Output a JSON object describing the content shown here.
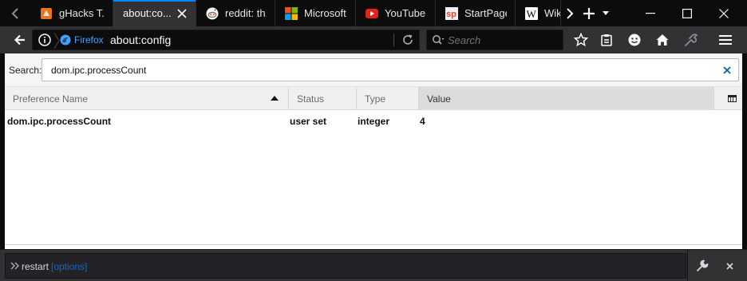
{
  "tabs": [
    {
      "title": "gHacks T...",
      "icon": "ghacks-favicon",
      "selected": false
    },
    {
      "title": "about:co...",
      "icon": "none",
      "selected": true
    },
    {
      "title": "reddit: th...",
      "icon": "reddit-favicon",
      "selected": false
    },
    {
      "title": "Microsoft...",
      "icon": "microsoft-favicon",
      "selected": false
    },
    {
      "title": "YouTube",
      "icon": "youtube-favicon",
      "selected": false
    },
    {
      "title": "StartPage...",
      "icon": "startpage-favicon",
      "selected": false
    },
    {
      "title": "Wikip",
      "icon": "wikipedia-favicon",
      "selected": false
    }
  ],
  "navbar": {
    "identity_label": "Firefox",
    "url": "about:config",
    "search_placeholder": "Search"
  },
  "config": {
    "search_label": "Search:",
    "filter_value": "dom.ipc.processCount",
    "columns": [
      "Preference Name",
      "Status",
      "Type",
      "Value"
    ],
    "sort_column": "Preference Name",
    "rows": [
      {
        "name": "dom.ipc.processCount",
        "status": "user set",
        "type": "integer",
        "value": "4"
      }
    ]
  },
  "devtoolbar": {
    "command": "restart",
    "hint": "[options]"
  },
  "colors": {
    "accent": "#0a84ff",
    "tabstrip_bg": "#0c0c0d",
    "toolbar_bg": "#323234",
    "identity_text": "#45a1ff"
  }
}
